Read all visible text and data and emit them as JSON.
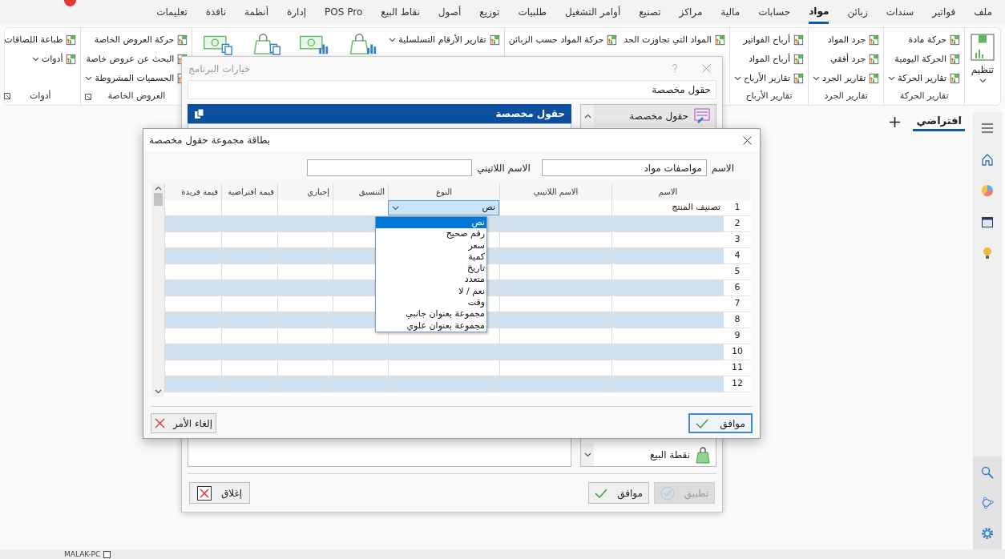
{
  "menu_bar": {
    "items": [
      {
        "label": "ملف",
        "selected": false
      },
      {
        "label": "فواتير",
        "selected": false
      },
      {
        "label": "سندات",
        "selected": false
      },
      {
        "label": "زبائن",
        "selected": false
      },
      {
        "label": "مواد",
        "selected": true
      },
      {
        "label": "حسابات",
        "selected": false
      },
      {
        "label": "مالية",
        "selected": false
      },
      {
        "label": "مراكز",
        "selected": false
      },
      {
        "label": "تصنيع",
        "selected": false
      },
      {
        "label": "أوامر التشغيل",
        "selected": false
      },
      {
        "label": "طلبيات",
        "selected": false
      },
      {
        "label": "توزيع",
        "selected": false
      },
      {
        "label": "أصول",
        "selected": false
      },
      {
        "label": "نقاط البيع",
        "selected": false
      },
      {
        "label": "POS Pro",
        "selected": false
      },
      {
        "label": "إدارة",
        "selected": false
      },
      {
        "label": "أنظمة",
        "selected": false
      },
      {
        "label": "نافذة",
        "selected": false
      },
      {
        "label": "تعليمات",
        "selected": false
      }
    ]
  },
  "ribbon": {
    "groups": [
      {
        "columns": [
          [
            {
              "kind": "big",
              "label": "تنظيم",
              "dropdown": true
            }
          ]
        ]
      },
      {
        "label": "تقارير الحركة",
        "columns": [
          [
            {
              "kind": "small",
              "label": "حركة مادة",
              "dropdown": false
            },
            {
              "kind": "small",
              "label": "الحركة اليومية",
              "dropdown": false
            },
            {
              "kind": "small",
              "label": "تقارير الحركة",
              "dropdown": true
            }
          ]
        ]
      },
      {
        "label": "تقارير الجرد",
        "columns": [
          [
            {
              "kind": "small",
              "label": "جرد المواد",
              "dropdown": false
            },
            {
              "kind": "small",
              "label": "جرد أفقي",
              "dropdown": false
            },
            {
              "kind": "small",
              "label": "تقارير الجرد",
              "dropdown": true
            }
          ]
        ]
      },
      {
        "label": "تقارير الأرباح",
        "columns": [
          [
            {
              "kind": "small",
              "label": "أرباح الفواتير",
              "dropdown": false
            },
            {
              "kind": "small",
              "label": "أرباح المواد",
              "dropdown": false
            },
            {
              "kind": "small",
              "label": "تقارير الأرباح",
              "dropdown": true
            }
          ]
        ]
      },
      {
        "columns": [
          [
            {
              "kind": "small",
              "label": "المواد التي تجاوزت الحد",
              "dropdown": false
            }
          ],
          [
            {
              "kind": "small",
              "label": "حركة المواد حسب الزبائن",
              "dropdown": false
            }
          ]
        ]
      },
      {
        "columns": [
          [
            {
              "kind": "small",
              "label": "تقارير الأرقام التسلسلية",
              "dropdown": true
            }
          ],
          [
            {
              "kind": "large"
            }
          ],
          [
            {
              "kind": "large"
            }
          ],
          [
            {
              "kind": "large"
            }
          ],
          [
            {
              "kind": "large"
            }
          ]
        ]
      },
      {
        "label": "العروض الخاصة",
        "launcher": true,
        "columns": [
          [
            {
              "kind": "small",
              "label": "حركة العروض الخاصة",
              "dropdown": false
            },
            {
              "kind": "small",
              "label": "البحث عن عروض خاصة",
              "dropdown": false
            },
            {
              "kind": "small",
              "label": "الحسميات المشروطة",
              "dropdown": true
            }
          ]
        ]
      },
      {
        "label": "أدوات",
        "launcher": true,
        "columns": [
          [
            {
              "kind": "small",
              "label": "طباعة اللصاقات",
              "dropdown": false
            },
            {
              "kind": "small",
              "label": "أدوات",
              "dropdown": true
            }
          ]
        ]
      }
    ]
  },
  "tabs": [
    {
      "label": "افتراضي",
      "selected": true
    }
  ],
  "options_dialog": {
    "title": "خيارات البرنامج",
    "search": {
      "value": "حقول مخصصة"
    },
    "nav": [
      {
        "label": "حقول مخصصة",
        "selected": true
      },
      {
        "label": "نقطة البيع",
        "selected": false
      }
    ],
    "panel_title": "حقول مخصصة",
    "buttons": [
      {
        "kind": "apply",
        "label": "تطبيق",
        "disabled": true
      },
      {
        "kind": "ok",
        "label": "موافق",
        "disabled": false
      },
      {
        "kind": "close",
        "label": "إغلاق",
        "disabled": false
      }
    ]
  },
  "group_dialog": {
    "title": "بطاقة مجموعة حقول مخصصة",
    "name_label": "الاسم",
    "name_value": "مواصفات مواد",
    "latin_label": "الاسم اللاتيني",
    "columns": [
      "الاسم",
      "الاسم اللاتيني",
      "النوع",
      "التنسيق",
      "إجباري",
      "قيمة افتراضية",
      "قيمة فريدة"
    ],
    "rows": [
      {
        "number": "1",
        "name": "تصنيف المنتج",
        "type": "نص"
      },
      {
        "number": "2"
      },
      {
        "number": "3"
      },
      {
        "number": "4"
      },
      {
        "number": "5"
      },
      {
        "number": "6"
      },
      {
        "number": "7"
      },
      {
        "number": "8"
      },
      {
        "number": "9"
      },
      {
        "number": "10"
      },
      {
        "number": "11"
      },
      {
        "number": "12"
      }
    ],
    "type_options": [
      {
        "label": "نص",
        "selected": true
      },
      {
        "label": "رقم صحيح",
        "selected": false
      },
      {
        "label": "سعر",
        "selected": false
      },
      {
        "label": "كمية",
        "selected": false
      },
      {
        "label": "تاريخ",
        "selected": false
      },
      {
        "label": "متعدد",
        "selected": false
      },
      {
        "label": "نعم / لا",
        "selected": false
      },
      {
        "label": "وقت",
        "selected": false
      },
      {
        "label": "مجموعة بعنوان جانبي",
        "selected": false
      },
      {
        "label": "مجموعة بعنوان علوي",
        "selected": false
      }
    ],
    "buttons": [
      {
        "kind": "ok",
        "label": "موافق"
      },
      {
        "kind": "cancel",
        "label": "إلغاء الأمر"
      }
    ]
  },
  "status_bar": {
    "computer": "MALAK-PC"
  }
}
